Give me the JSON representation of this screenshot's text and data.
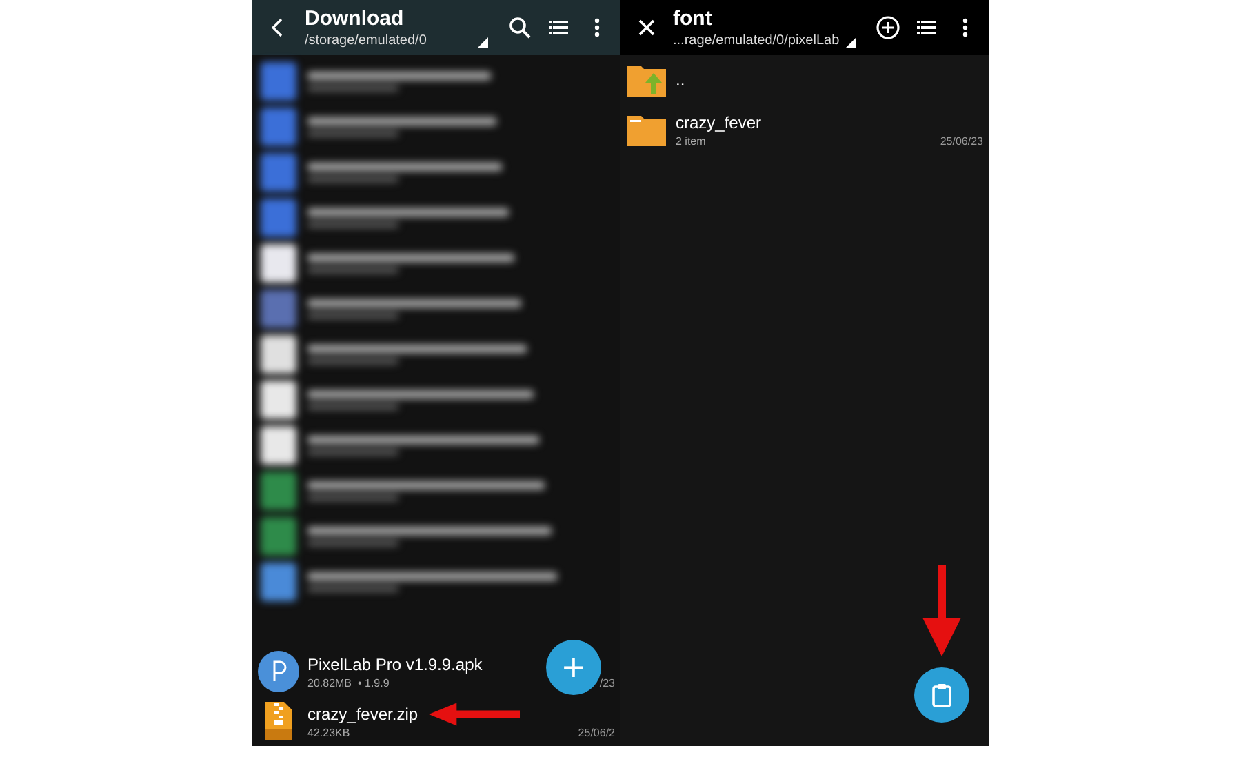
{
  "left_panel": {
    "header": {
      "title": "Download",
      "path": "/storage/emulated/0"
    },
    "files": [
      {
        "kind": "app",
        "name": "PixelLab Pro v1.9.9.apk",
        "details": "20.82MB  • 1.9.9",
        "date": "/23"
      },
      {
        "kind": "zip",
        "name": "crazy_fever.zip",
        "details": "42.23KB",
        "date": "25/06/2"
      }
    ],
    "fab": {
      "label": "+"
    }
  },
  "right_panel": {
    "header": {
      "title": "font",
      "path": "...rage/emulated/0/pixelLab"
    },
    "folders": [
      {
        "kind": "parent",
        "name": ".."
      },
      {
        "kind": "folder",
        "name": "crazy_fever",
        "details": "2 item",
        "date": "25/06/23"
      }
    ]
  }
}
